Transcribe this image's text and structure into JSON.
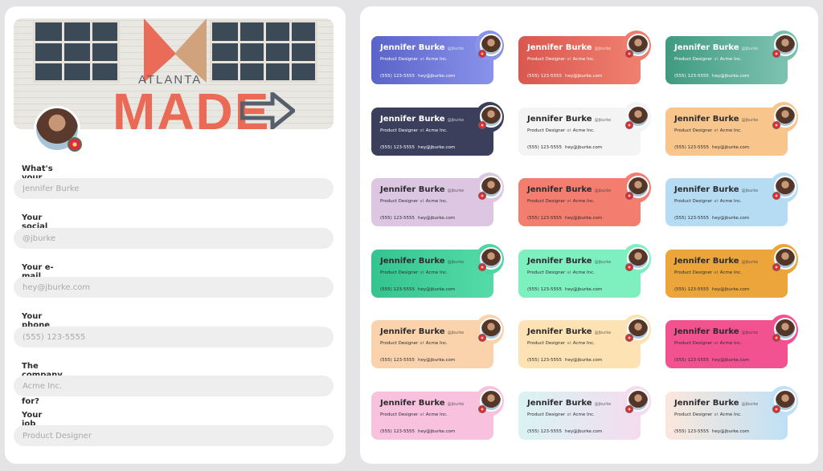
{
  "banner": {
    "line1": "ATLANTA",
    "line2": "MADE"
  },
  "form": {
    "fields": [
      {
        "label": "What's your name?",
        "placeholder": "Jennifer Burke"
      },
      {
        "label": "Your social media handle?",
        "placeholder": "@jburke"
      },
      {
        "label": "Your e-mail address?",
        "placeholder": "hey@jburke.com"
      },
      {
        "label": "Your phone number?",
        "placeholder": "(555) 123-5555"
      },
      {
        "label": "The company you work for?",
        "placeholder": "Acme Inc."
      },
      {
        "label": "Your job title?",
        "placeholder": "Product Designer"
      }
    ]
  },
  "signature": {
    "name": "Jennifer Burke",
    "handle": "@jburke",
    "title": "Product Designer",
    "at": "at",
    "company": "Acme Inc.",
    "phone": "(555) 123-5555",
    "email": "hey@jburke.com"
  },
  "themes": [
    {
      "bg": "linear-gradient(90deg,#5a63c8,#8a93ea)",
      "text": "#ffffff",
      "bump": "#8a92e9"
    },
    {
      "bg": "linear-gradient(90deg,#d9574f,#f08070)",
      "text": "#ffffff",
      "bump": "#ef7d6e"
    },
    {
      "bg": "linear-gradient(90deg,#3f9a80,#7ec3b2)",
      "text": "#ffffff",
      "bump": "#78c0ad"
    },
    {
      "bg": "#3b3f5c",
      "text": "#ffffff",
      "bump": "#3b3f5c"
    },
    {
      "bg": "#f4f4f5",
      "text": "#2c2c30",
      "bump": "#f4f4f5"
    },
    {
      "bg": "#f8c68d",
      "text": "#2c2c30",
      "bump": "#f8c68d"
    },
    {
      "bg": "#dcc6e2",
      "text": "#2c2c30",
      "bump": "#dcc6e2"
    },
    {
      "bg": "#f37d6e",
      "text": "#2c2c30",
      "bump": "#f37d6e"
    },
    {
      "bg": "#b5dcf3",
      "text": "#2c2c30",
      "bump": "#b5dcf3"
    },
    {
      "bg": "linear-gradient(90deg,#34c48f,#55dba8)",
      "text": "#2c2c30",
      "bump": "#4fd7a3"
    },
    {
      "bg": "#7ef0c0",
      "text": "#2c2c30",
      "bump": "#7ef0c0"
    },
    {
      "bg": "#eba53a",
      "text": "#2c2c30",
      "bump": "#eba53a"
    },
    {
      "bg": "#fad2ab",
      "text": "#2c2c30",
      "bump": "#fad2ab"
    },
    {
      "bg": "#fde3b3",
      "text": "#2c2c30",
      "bump": "#fde3b3"
    },
    {
      "bg": "#f2528f",
      "text": "#2c2c30",
      "bump": "#f2528f"
    },
    {
      "bg": "#f8c1dd",
      "text": "#2c2c30",
      "bump": "#f8c1dd"
    },
    {
      "bg": "linear-gradient(90deg,#d9f3f3,#f4dcef)",
      "text": "#2c2c30",
      "bump": "#f4dcef"
    },
    {
      "bg": "linear-gradient(90deg,#fbe7dc,#bfe1f5)",
      "text": "#2c2c30",
      "bump": "#bfe1f5"
    }
  ]
}
